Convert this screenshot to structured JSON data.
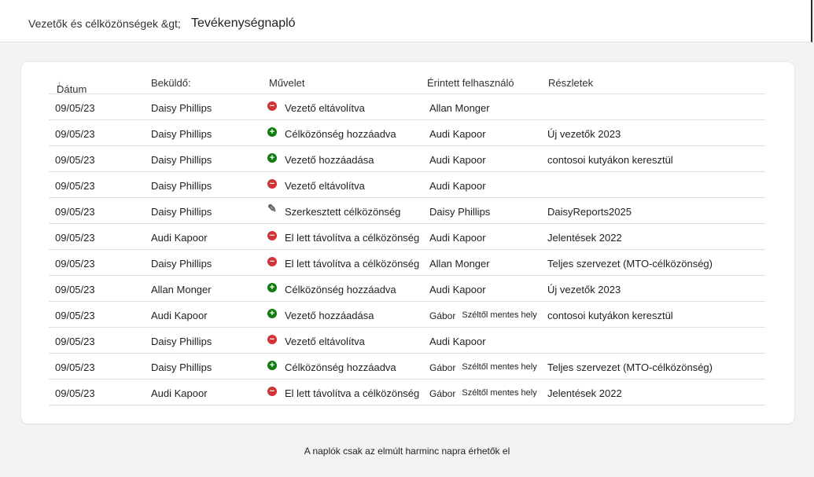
{
  "header": {
    "breadcrumb": "Vezetők és célközönségek &gt;",
    "title": "Tevékenységnapló"
  },
  "table": {
    "columns": {
      "date": "Dátum",
      "date_sort_icon": "↓",
      "sender": "Beküldő:",
      "action": "Művelet",
      "user": "Érintett felhasználó",
      "details": "Részletek"
    },
    "rows": [
      {
        "date": "09/05/23",
        "sender": "Daisy Phillips",
        "icon": "remove-icon",
        "action": "Vezető eltávolítva",
        "user": "Allan Monger",
        "extra": "",
        "details": ""
      },
      {
        "date": "09/05/23",
        "sender": "Daisy Phillips",
        "icon": "add-icon",
        "action": "Célközönség hozzáadva",
        "user": "Audi Kapoor",
        "extra": "",
        "details": "Új vezetők 2023"
      },
      {
        "date": "09/05/23",
        "sender": "Daisy Phillips",
        "icon": "add-icon",
        "action": "Vezető hozzáadása",
        "user": "Audi Kapoor",
        "extra": "",
        "details": "contosoi kutyákon keresztül"
      },
      {
        "date": "09/05/23",
        "sender": "Daisy Phillips",
        "icon": "remove-icon",
        "action": "Vezető eltávolítva",
        "user": "Audi Kapoor",
        "extra": "",
        "details": ""
      },
      {
        "date": "09/05/23",
        "sender": "Daisy Phillips",
        "icon": "edit-icon",
        "action": "Szerkesztett célközönség",
        "user": "Daisy Phillips",
        "extra": "",
        "details": "DaisyReports2025"
      },
      {
        "date": "09/05/23",
        "sender": "Audi Kapoor",
        "icon": "remove-icon",
        "action": "El lett távolítva a célközönség",
        "user": "Audi Kapoor",
        "extra": "",
        "details": "Jelentések 2022"
      },
      {
        "date": "09/05/23",
        "sender": "Daisy Phillips",
        "icon": "remove-icon",
        "action": "El lett távolítva a célközönség",
        "user": "Allan Monger",
        "extra": "",
        "details": "Teljes szervezet (MTO-célközönség)"
      },
      {
        "date": "09/05/23",
        "sender": "Allan Monger",
        "icon": "add-icon",
        "action": "Célközönség hozzáadva",
        "user": "Audi Kapoor",
        "extra": "",
        "details": "Új vezetők 2023"
      },
      {
        "date": "09/05/23",
        "sender": "Audi Kapoor",
        "icon": "add-icon",
        "action": "Vezető hozzáadása",
        "user": "Gábor",
        "extra": "Széltől mentes hely",
        "details": "contosoi kutyákon keresztül"
      },
      {
        "date": "09/05/23",
        "sender": "Daisy Phillips",
        "icon": "remove-icon",
        "action": "Vezető eltávolítva",
        "user": "Audi Kapoor",
        "extra": "",
        "details": ""
      },
      {
        "date": "09/05/23",
        "sender": "Daisy Phillips",
        "icon": "add-icon",
        "action": "Célközönség hozzáadva",
        "user": "Gábor",
        "extra": "Széltől mentes hely",
        "details": "Teljes szervezet (MTO-célközönség)"
      },
      {
        "date": "09/05/23",
        "sender": "Audi Kapoor",
        "icon": "remove-icon",
        "action": "El lett távolítva a célközönség",
        "user": "Gábor",
        "extra": "Széltől mentes hely",
        "details": "Jelentések 2022"
      }
    ]
  },
  "footer": {
    "note": "A naplók csak az elmúlt harminc napra érhetők el"
  },
  "colors": {
    "remove": "#d13438",
    "add": "#107c10",
    "edit": "#605e5c"
  }
}
